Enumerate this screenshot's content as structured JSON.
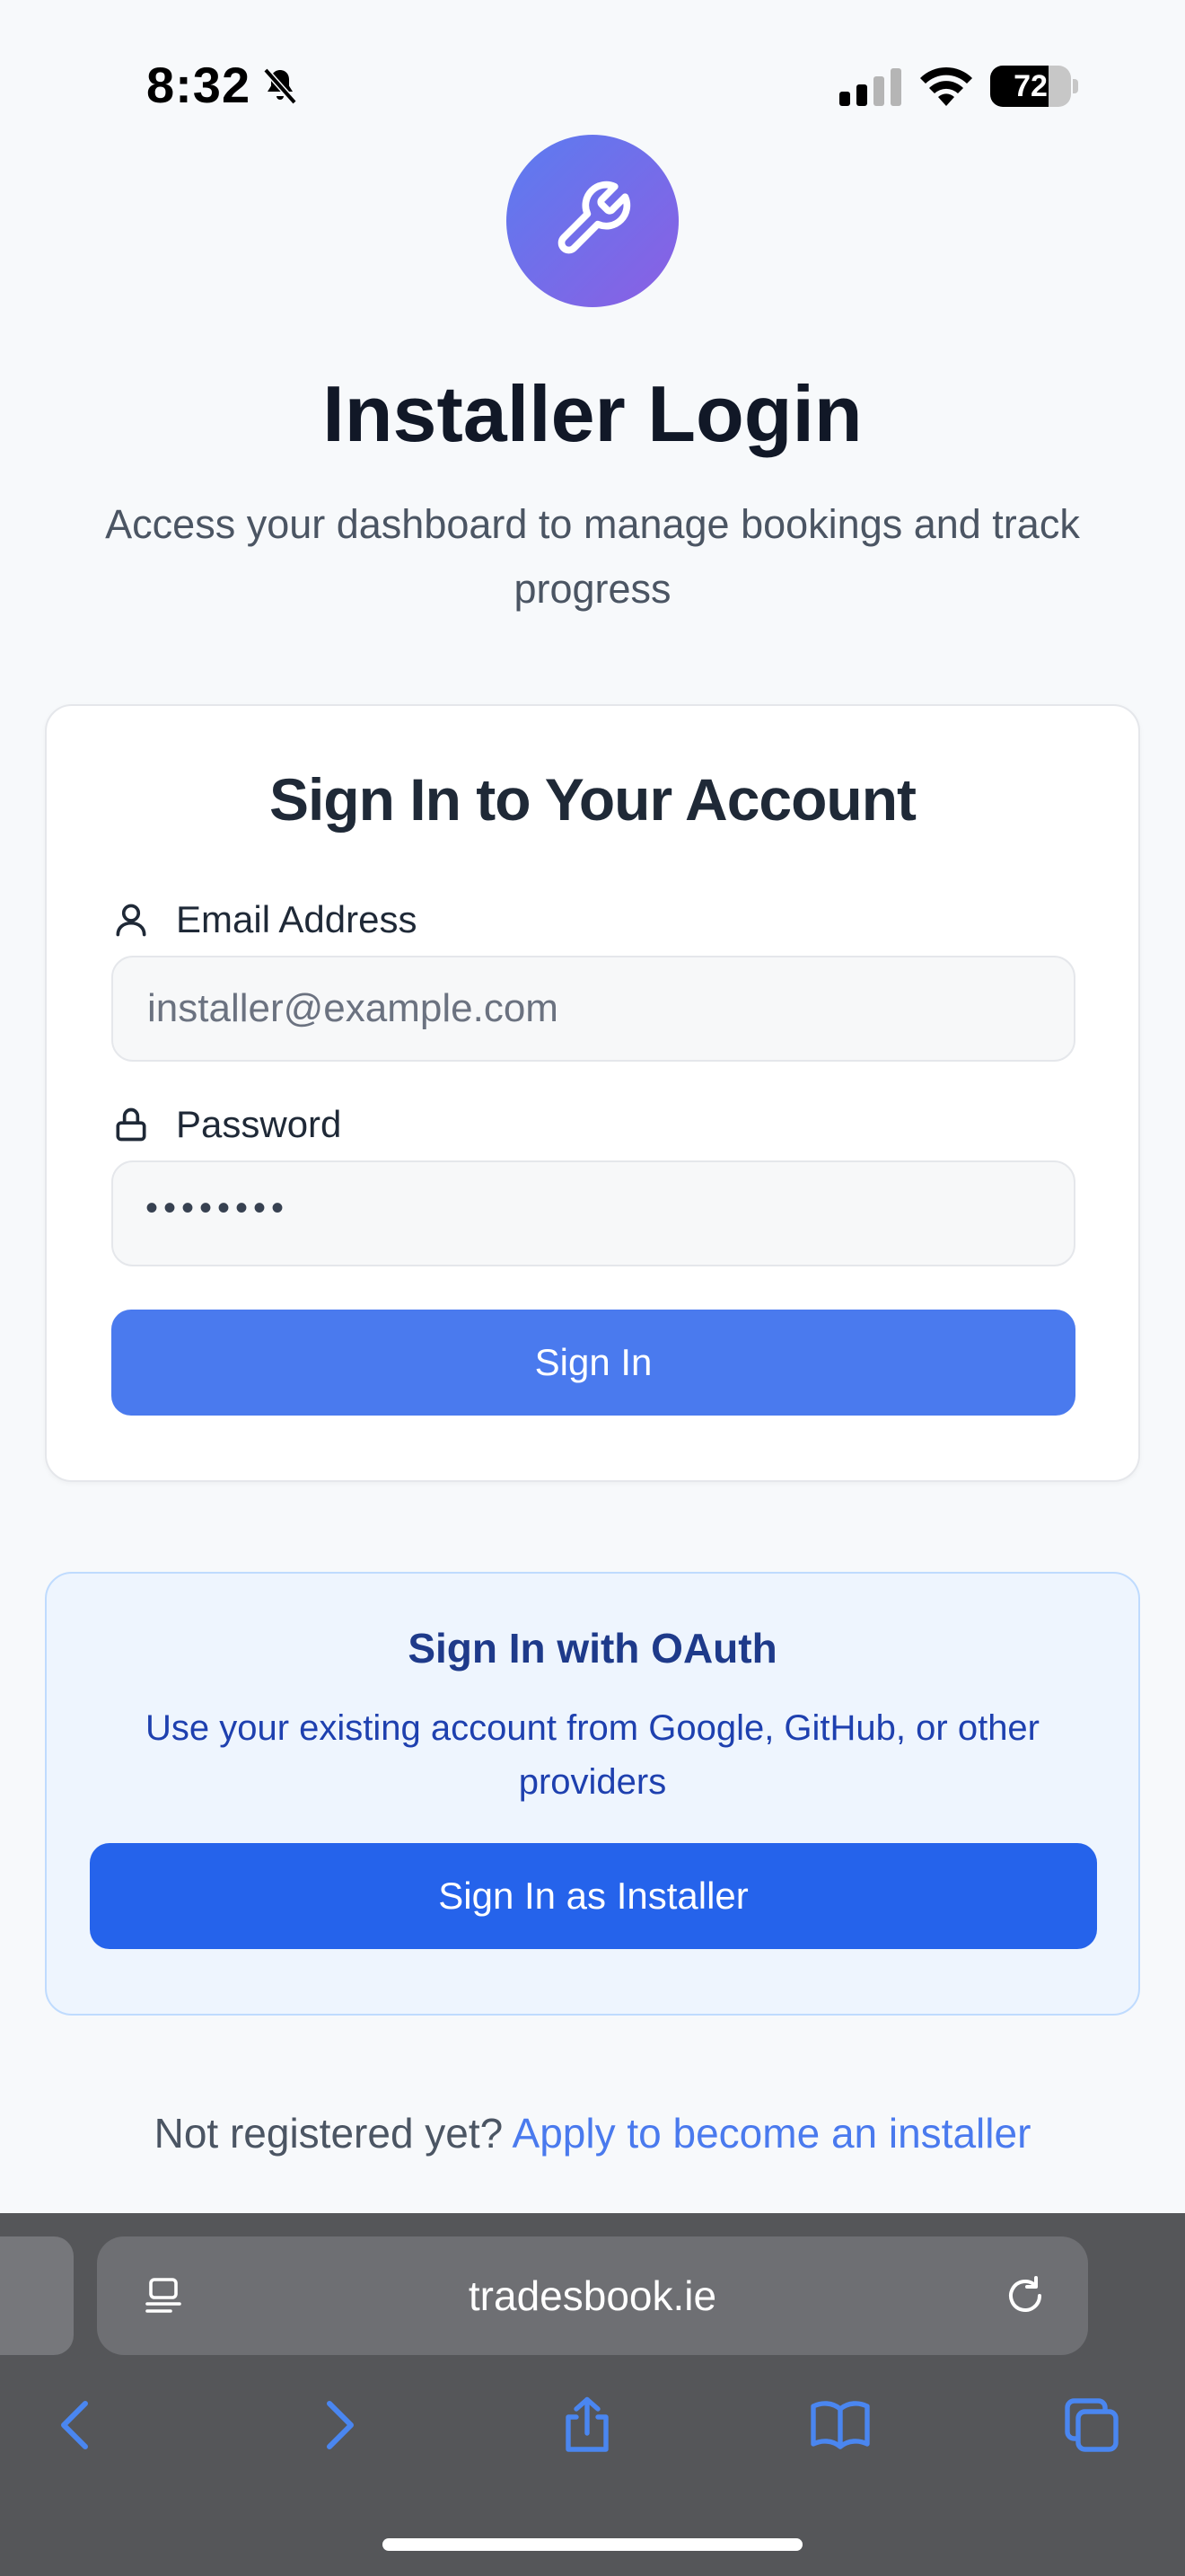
{
  "status_bar": {
    "time": "8:32",
    "battery_level": "72",
    "battery_fraction": 0.72
  },
  "hero": {
    "title": "Installer Login",
    "subtitle": "Access your dashboard to manage bookings and track progress"
  },
  "login_card": {
    "title": "Sign In to Your Account",
    "email_label": "Email Address",
    "email_placeholder": "installer@example.com",
    "password_label": "Password",
    "password_value": "••••••••",
    "submit_label": "Sign In"
  },
  "oauth_card": {
    "title": "Sign In with OAuth",
    "description": "Use your existing account from Google, GitHub, or other providers",
    "button_label": "Sign In as Installer"
  },
  "footer": {
    "prompt": "Not registered yet?",
    "link_label": "Apply to become an installer"
  },
  "browser": {
    "url": "tradesbook.ie"
  },
  "icons": {
    "logo": "wrench-icon",
    "email": "user-icon",
    "password": "lock-icon"
  },
  "colors": {
    "accent": "#4a7aee",
    "oauth_button": "#2563eb",
    "logo_gradient_start": "#5b7cf0",
    "logo_gradient_end": "#8b5fe3"
  }
}
